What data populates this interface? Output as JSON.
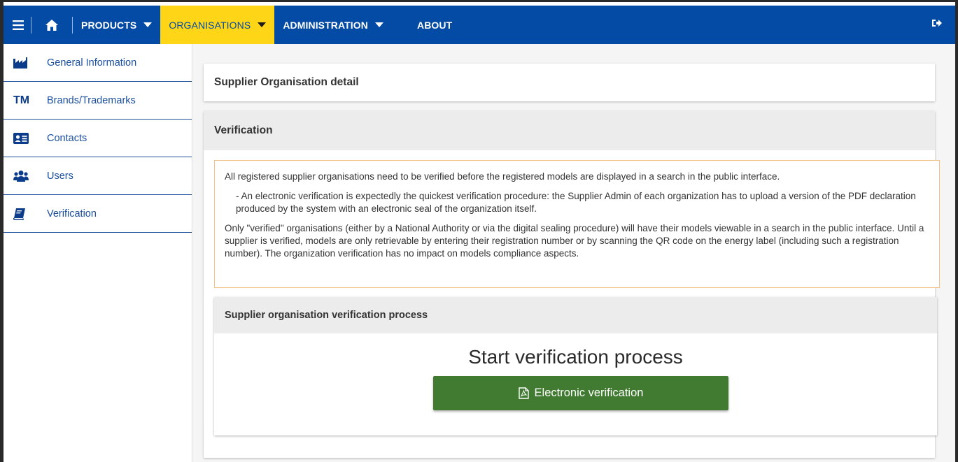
{
  "navbar": {
    "menu_icon": "hamburger-icon",
    "home_icon": "home-icon",
    "items": [
      {
        "label": "PRODUCTS"
      },
      {
        "label": "ORGANISATIONS"
      },
      {
        "label": "ADMINISTRATION"
      },
      {
        "label": "ABOUT"
      }
    ],
    "logout_icon": "logout-icon",
    "colors": {
      "bar": "#044ba5",
      "active": "#ffd617"
    }
  },
  "sidebar": {
    "items": [
      {
        "label": "General Information",
        "icon": "factory-icon"
      },
      {
        "label": "Brands/Trademarks",
        "icon": "TM"
      },
      {
        "label": "Contacts",
        "icon": "contact-card-icon"
      },
      {
        "label": "Users",
        "icon": "users-icon"
      },
      {
        "label": "Verification",
        "icon": "book-icon"
      }
    ]
  },
  "main": {
    "detail_title": "Supplier Organisation detail",
    "verification": {
      "title": "Verification",
      "notice": {
        "p1": "All registered supplier organisations need to be verified before the registered models are displayed in a search in the public interface.",
        "p2": "- An electronic verification is expectedly the quickest verification procedure: the Supplier Admin of each organization has to upload a version of the PDF declaration produced by the system with an electronic seal of the organization itself.",
        "p3": "Only \"verified\" organisations (either by a National Authority or via the digital sealing procedure) will have their models viewable in a search in the public interface. Until a supplier is verified, models are only retrievable by entering their registration number or by scanning the QR code on the energy label (including such a registration number). The organization verification has no impact on models compliance aspects."
      },
      "process": {
        "title": "Supplier organisation verification process",
        "start_title": "Start verification process",
        "button_label": "Electronic verification",
        "button_icon": "pdf-file-icon",
        "button_color": "#417a31"
      }
    }
  }
}
